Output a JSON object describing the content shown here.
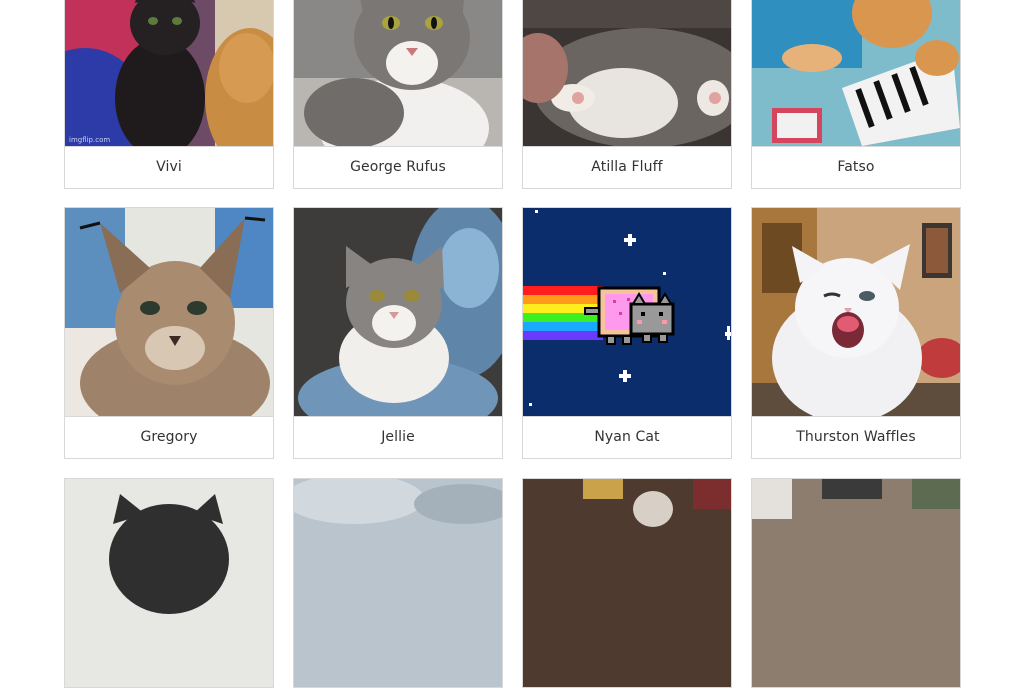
{
  "cats": [
    {
      "name": "Vivi",
      "scene": "black-kitten",
      "watermark": "imgflip.com"
    },
    {
      "name": "George Rufus",
      "scene": "grey-white-cat"
    },
    {
      "name": "Atilla Fluff",
      "scene": "belly-cat"
    },
    {
      "name": "Fatso",
      "scene": "keyboard-cat"
    },
    {
      "name": "Gregory",
      "scene": "caracal"
    },
    {
      "name": "Jellie",
      "scene": "blanket-cat"
    },
    {
      "name": "Nyan Cat",
      "scene": "nyan-cat"
    },
    {
      "name": "Thurston Waffles",
      "scene": "white-cat"
    },
    {
      "name": "",
      "scene": "cat-photo"
    },
    {
      "name": "",
      "scene": "cat-photo"
    },
    {
      "name": "",
      "scene": "cat-photo"
    },
    {
      "name": "",
      "scene": "cat-photo"
    }
  ],
  "colors": {
    "border": "#d8d8d8",
    "label_text": "#333333",
    "nyan_sky": "#0c2d6b"
  }
}
